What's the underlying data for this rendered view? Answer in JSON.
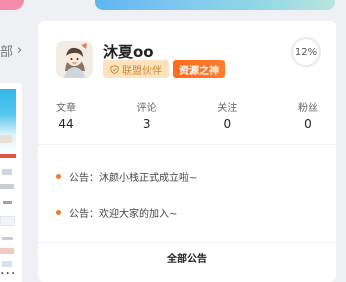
{
  "left_panel": {
    "label": "部",
    "chevron_glyph": "›",
    "more_glyph": "..."
  },
  "profile": {
    "username": "沐夏oo",
    "level_percent": "12%",
    "badges": {
      "league_icon": "shield-icon",
      "league_label": "联盟伙伴",
      "god_label": "资源之神"
    }
  },
  "stats": [
    {
      "label": "文章",
      "value": "44"
    },
    {
      "label": "评论",
      "value": "3"
    },
    {
      "label": "关注",
      "value": "0"
    },
    {
      "label": "粉丝",
      "value": "0"
    }
  ],
  "notices": [
    {
      "text": "公告：沐颜小栈正式成立啦~"
    },
    {
      "text": "公告：欢迎大家的加入~"
    }
  ],
  "footer": {
    "all_notices_label": "全部公告"
  },
  "colors": {
    "accent_orange": "#f07a2a",
    "badge_league_bg": "#fde2bd",
    "badge_god_bg": "#ff6a1a"
  }
}
